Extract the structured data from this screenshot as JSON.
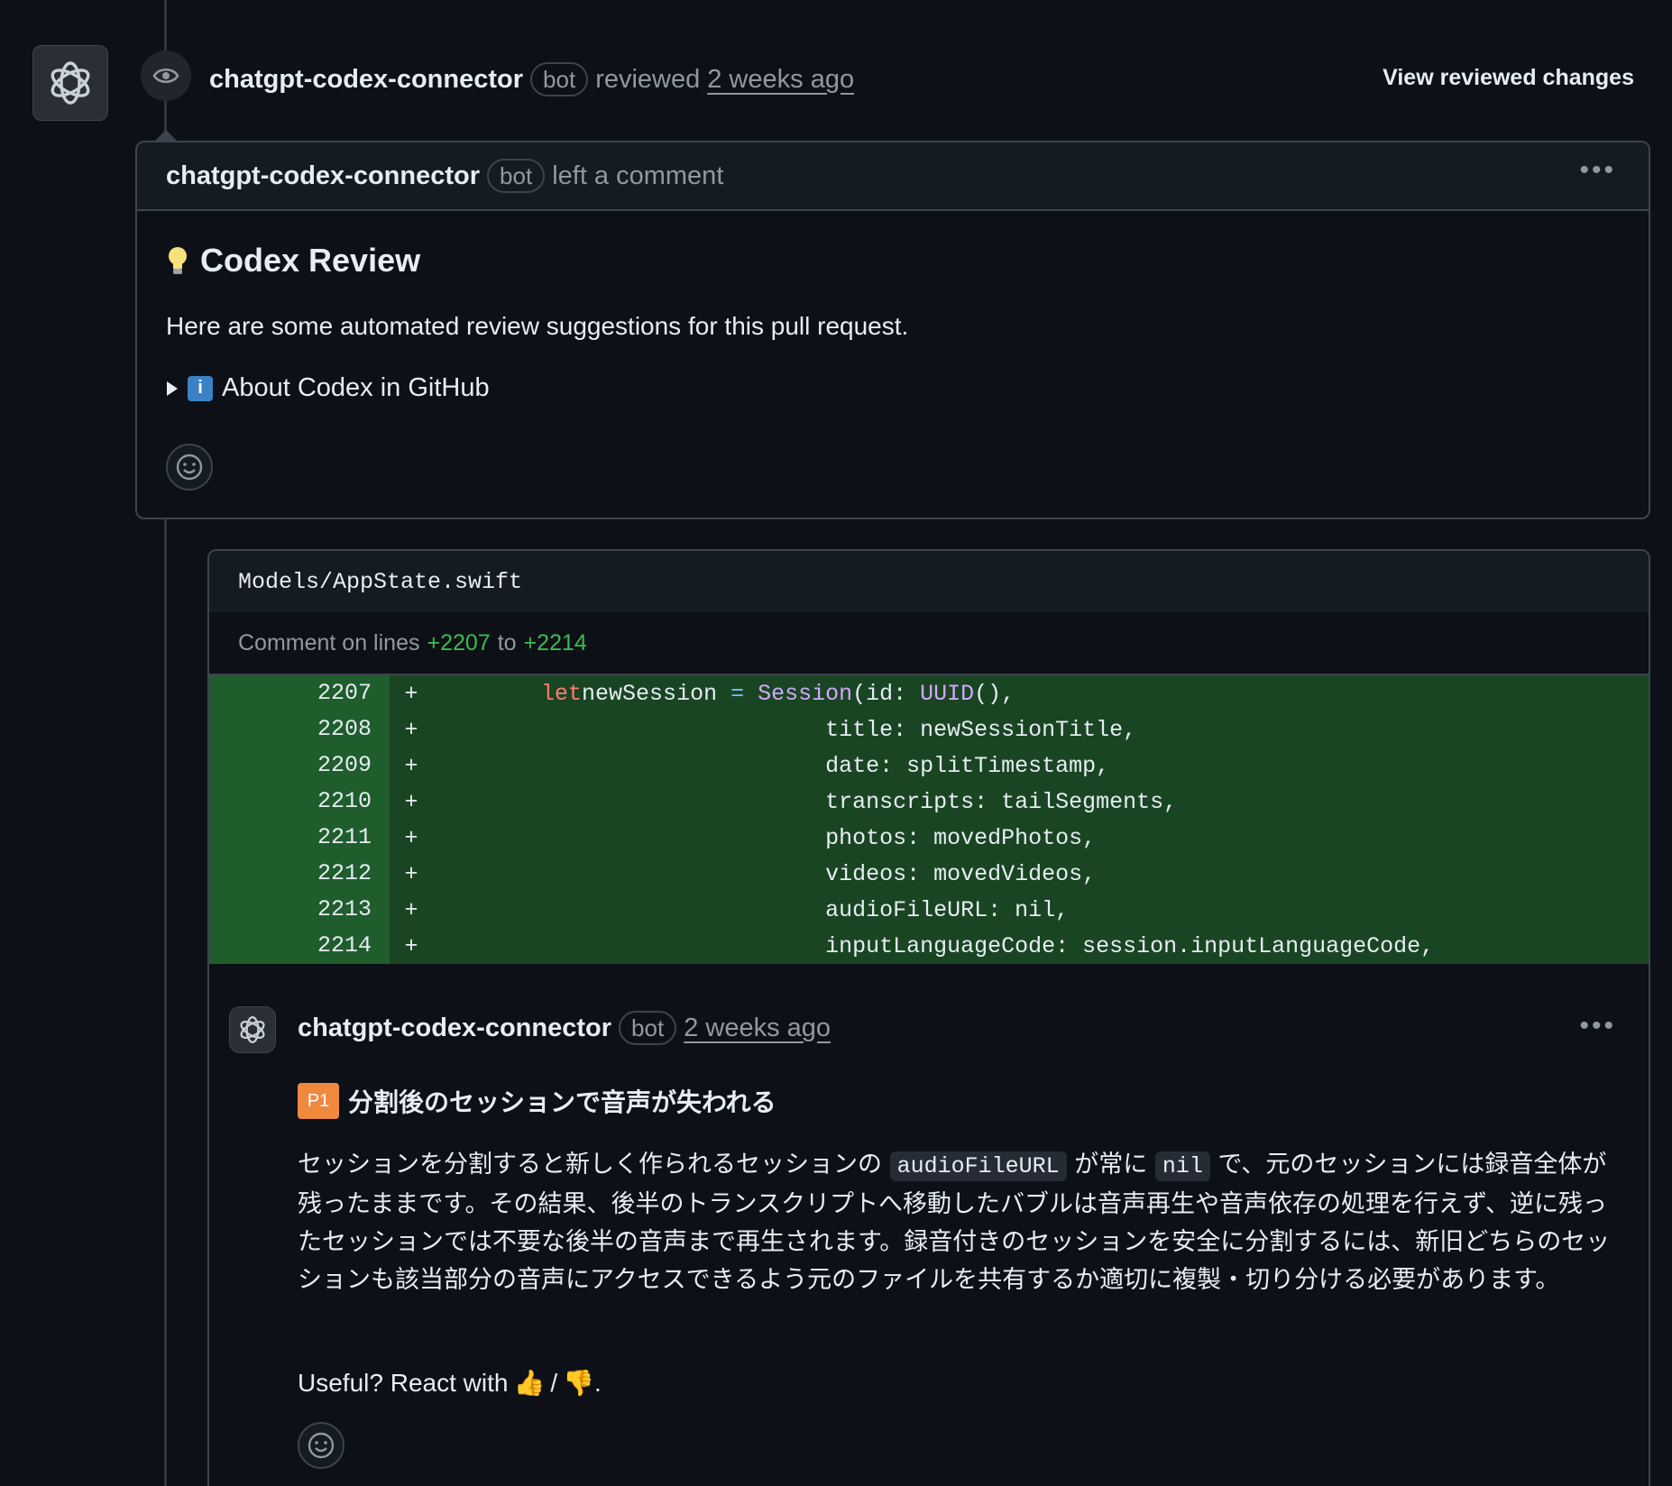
{
  "review": {
    "author": "chatgpt-codex-connector",
    "badge": "bot",
    "action": "reviewed",
    "time": "2 weeks ago",
    "view_changes_label": "View reviewed changes"
  },
  "comment": {
    "author": "chatgpt-codex-connector",
    "badge": "bot",
    "action": "left a comment",
    "title": "Codex Review",
    "body": "Here are some automated review suggestions for this pull request.",
    "details_label": "About Codex in GitHub"
  },
  "file": {
    "path": "Models/AppState.swift",
    "comment_on_prefix": "Comment on lines",
    "line_start": "+2207",
    "to_word": "to",
    "line_end": "+2214",
    "diff_lines": [
      {
        "num": "2207",
        "sign": "+",
        "pre": "        ",
        "tokens": [
          [
            "kw",
            "let"
          ],
          [
            "",
            "newSession "
          ],
          [
            "op",
            "="
          ],
          [
            "",
            " "
          ],
          [
            "ty",
            "Session"
          ],
          [
            "",
            "(id: "
          ],
          [
            "ty",
            "UUID"
          ],
          [
            "",
            "(),"
          ]
        ]
      },
      {
        "num": "2208",
        "sign": "+",
        "pre": "                             ",
        "tokens": [
          [
            "",
            "title: newSessionTitle,"
          ]
        ]
      },
      {
        "num": "2209",
        "sign": "+",
        "pre": "                             ",
        "tokens": [
          [
            "",
            "date: splitTimestamp,"
          ]
        ]
      },
      {
        "num": "2210",
        "sign": "+",
        "pre": "                             ",
        "tokens": [
          [
            "",
            "transcripts: tailSegments,"
          ]
        ]
      },
      {
        "num": "2211",
        "sign": "+",
        "pre": "                             ",
        "tokens": [
          [
            "",
            "photos: movedPhotos,"
          ]
        ]
      },
      {
        "num": "2212",
        "sign": "+",
        "pre": "                             ",
        "tokens": [
          [
            "",
            "videos: movedVideos,"
          ]
        ]
      },
      {
        "num": "2213",
        "sign": "+",
        "pre": "                             ",
        "tokens": [
          [
            "",
            "audioFileURL: nil,"
          ]
        ]
      },
      {
        "num": "2214",
        "sign": "+",
        "pre": "                             ",
        "tokens": [
          [
            "",
            "inputLanguageCode: session.inputLanguageCode,"
          ]
        ]
      }
    ]
  },
  "inline_comment": {
    "author": "chatgpt-codex-connector",
    "badge": "bot",
    "time": "2 weeks ago",
    "priority": "P1",
    "title": "分割後のセッションで音声が失われる",
    "para_1": "セッションを分割すると新しく作られるセッションの",
    "code_1": "audioFileURL",
    "para_2": "が常に",
    "code_2": "nil",
    "para_3": "で、元のセッションには録音全体が残ったままです。その結果、後半のトランスクリプトへ移動したバブルは音声再生や音声依存の処理を行えず、逆に残ったセッションでは不要な後半の音声まで再生されます。録音付きのセッションを安全に分割するには、新旧どちらのセッションも該当部分の音声にアクセスできるよう元のファイルを共有するか適切に複製・切り分ける必要があります。",
    "useful_text": "Useful? React with",
    "thumbs_up": "👍",
    "slash": "/",
    "thumbs_down": "👎",
    "period": "."
  },
  "colors": {
    "background": "#0d1117",
    "diff_added": "#1a4523",
    "diff_added_gutter": "#1f5d2d",
    "priority_badge": "#f0883e",
    "line_ref_green": "#3fb950"
  }
}
